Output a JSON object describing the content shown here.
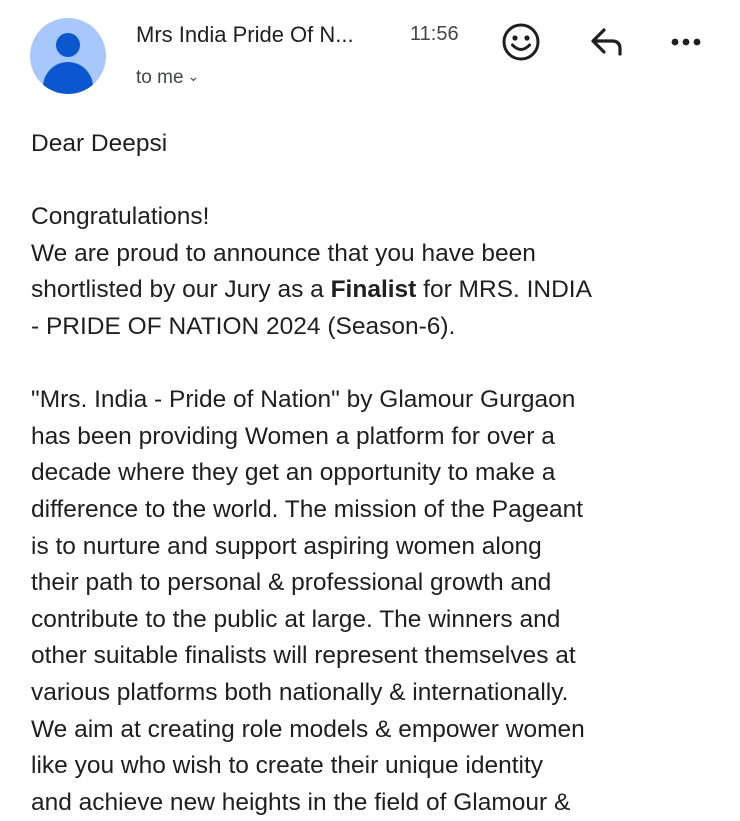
{
  "header": {
    "sender": "Mrs India Pride Of N...",
    "time": "11:56",
    "recipient": "to me",
    "icons": {
      "avatar": "person-avatar",
      "react": "smiley-icon",
      "reply": "reply-icon",
      "more": "more-horizontal-icon",
      "recipient_toggle": "chevron-down-icon"
    }
  },
  "email": {
    "greeting": "Dear Deepsi",
    "congrats": "Congratulations!",
    "para1": {
      "line1": "We are proud to announce that you have been",
      "line2_pre": "shortlisted by our Jury as a ",
      "line2_bold": "Finalist",
      "line2_post": " for MRS. INDIA",
      "line3": "- PRIDE OF NATION 2024 (Season-6)."
    },
    "para2_lines": [
      "\"Mrs. India - Pride of Nation\" by Glamour Gurgaon",
      "has been providing Women a platform for over a",
      "decade where they get an opportunity to make a",
      "difference to the world. The mission of the Pageant",
      "is to nurture and support aspiring women along",
      "their path to personal & professional growth and",
      "contribute to the public at large. The winners and",
      "other suitable finalists will represent themselves at",
      "various platforms both nationally & internationally.",
      "We aim at creating role models & empower women",
      "like you who wish to create their unique identity",
      "and achieve new heights in the field of Glamour &"
    ]
  },
  "colors": {
    "avatar_bg": "#a8c7fa",
    "avatar_fg": "#0b57d0",
    "text": "#1f1f1f",
    "secondary_text": "#444746"
  }
}
